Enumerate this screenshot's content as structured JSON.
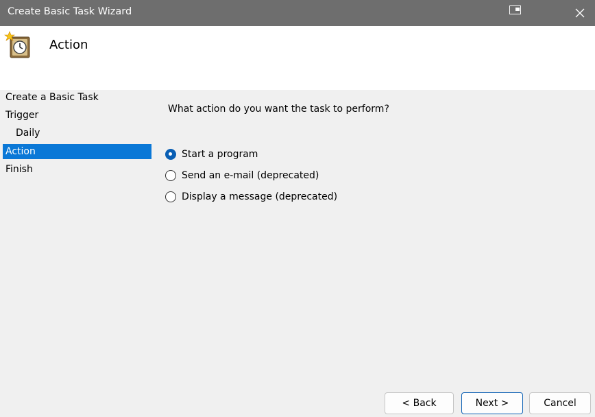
{
  "window": {
    "title": "Create Basic Task Wizard"
  },
  "header": {
    "title": "Action",
    "icon": "task-scheduler-clock-icon"
  },
  "sidebar": {
    "items": [
      {
        "label": "Create a Basic Task",
        "selected": false
      },
      {
        "label": "Trigger",
        "selected": false
      },
      {
        "label": "Daily",
        "selected": false,
        "indent": true
      },
      {
        "label": "Action",
        "selected": true
      },
      {
        "label": "Finish",
        "selected": false
      }
    ]
  },
  "main": {
    "question": "What action do you want the task to perform?",
    "options": [
      {
        "label": "Start a program",
        "checked": true
      },
      {
        "label": "Send an e-mail (deprecated)",
        "checked": false
      },
      {
        "label": "Display a message (deprecated)",
        "checked": false
      }
    ]
  },
  "buttons": {
    "back": "< Back",
    "next": "Next >",
    "cancel": "Cancel"
  },
  "colors": {
    "titlebar": "#6e6e6e",
    "selection": "#0a78d7",
    "accent": "#0a5fb4"
  }
}
